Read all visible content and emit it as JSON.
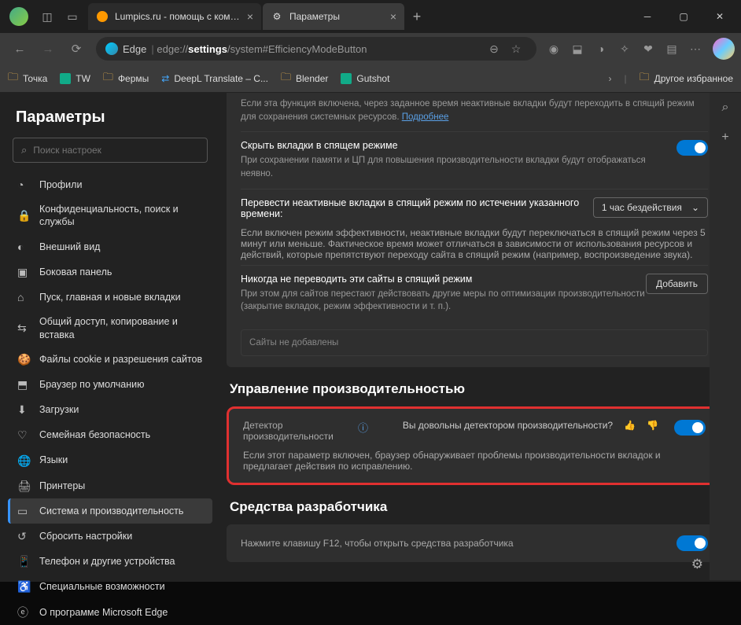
{
  "titlebar": {
    "tab1": "Lumpics.ru - помощь с компьют",
    "tab2": "Параметры"
  },
  "toolbar": {
    "edge": "Edge",
    "url_prefix": "edge://",
    "url_bold": "settings",
    "url_rest": "/system#EfficiencyModeButton"
  },
  "bookmarks": {
    "b1": "Точка",
    "b2": "TW",
    "b3": "Фермы",
    "b4": "DeepL Translate – C...",
    "b5": "Blender",
    "b6": "Gutshot",
    "other": "Другое избранное"
  },
  "sidebar": {
    "title": "Параметры",
    "search_ph": "Поиск настроек",
    "items": [
      "Профили",
      "Конфиденциальность, поиск и службы",
      "Внешний вид",
      "Боковая панель",
      "Пуск, главная и новые вкладки",
      "Общий доступ, копирование и вставка",
      "Файлы cookie и разрешения сайтов",
      "Браузер по умолчанию",
      "Загрузки",
      "Семейная безопасность",
      "Языки",
      "Принтеры",
      "Система и производительность",
      "Сбросить настройки",
      "Телефон и другие устройства",
      "Специальные возможности",
      "О программе Microsoft Edge"
    ]
  },
  "main": {
    "r0desc": "Если эта функция включена, через заданное время неактивные вкладки будут переходить в спящий режим для сохранения системных ресурсов. ",
    "r0link": "Подробнее",
    "r1title": "Скрыть вкладки в спящем режиме",
    "r1desc": "При сохранении памяти и ЦП для повышения производительности вкладки будут отображаться неявно.",
    "r2title": "Перевести неактивные вкладки в спящий режим по истечении указанного времени:",
    "r2select": "1 час бездействия",
    "r2desc": "Если включен режим эффективности, неактивные вкладки будут переключаться в спящий режим через 5 минут или меньше. Фактическое время может отличаться в зависимости от использования ресурсов и действий, которые препятствуют переходу сайта в спящий режим (например, воспроизведение звука).",
    "r3title": "Никогда не переводить эти сайты в спящий режим",
    "r3btn": "Добавить",
    "r3desc": "При этом для сайтов перестают действовать другие меры по оптимизации производительности (закрытие вкладок, режим эффективности и т. п.).",
    "r3empty": "Сайты не добавлены",
    "sec2": "Управление производительностью",
    "det_title": "Детектор производительности",
    "det_q": "Вы довольны детектором производительности?",
    "det_desc": "Если этот параметр включен, браузер обнаруживает проблемы производительности вкладок и предлагает действия по исправлению.",
    "sec3": "Средства разработчика",
    "f12": "Нажмите клавишу F12, чтобы открыть средства разработчика"
  }
}
